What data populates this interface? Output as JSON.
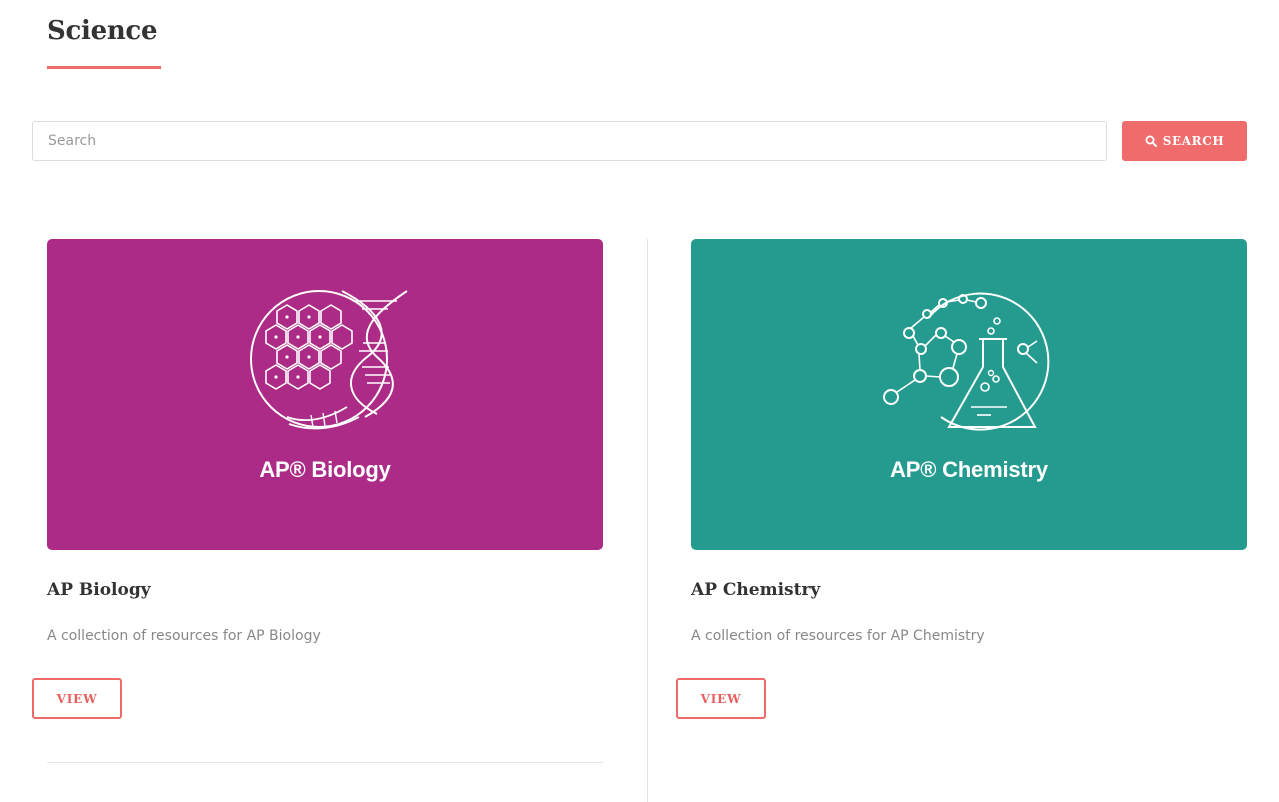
{
  "page": {
    "title": "Science"
  },
  "search": {
    "placeholder": "Search",
    "value": "",
    "button_label": "SEARCH",
    "button_icon": "search-icon"
  },
  "cards": [
    {
      "image_caption": "AP® Biology",
      "image_color": "#ab2b86",
      "image_icon": "dna-cell-icon",
      "title": "AP Biology",
      "description": "A collection of resources for AP Biology",
      "button_label": "VIEW"
    },
    {
      "image_caption": "AP® Chemistry",
      "image_color": "#249b8e",
      "image_icon": "flask-molecule-icon",
      "title": "AP Chemistry",
      "description": "A collection of resources for AP Chemistry",
      "button_label": "VIEW"
    }
  ],
  "colors": {
    "accent": "#f06b6b",
    "text_dark": "#333333",
    "text_muted": "#888888"
  }
}
